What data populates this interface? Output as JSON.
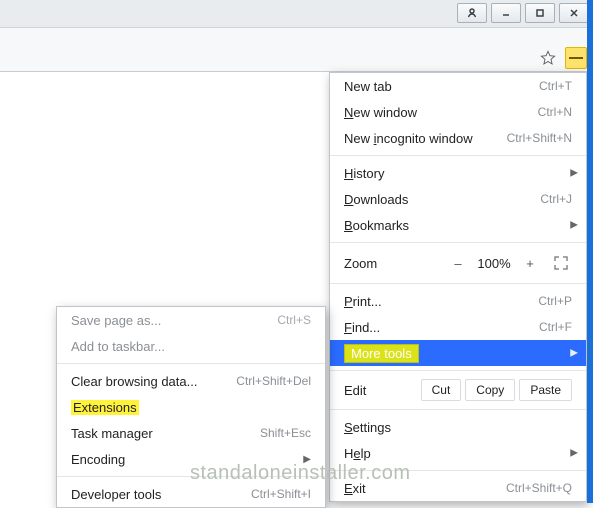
{
  "menu": {
    "new_tab": "New tab",
    "new_tab_sc": "Ctrl+T",
    "new_window": "New window",
    "new_window_sc": "Ctrl+N",
    "incognito": "New incognito window",
    "incognito_sc": "Ctrl+Shift+N",
    "history": "History",
    "downloads": "Downloads",
    "downloads_sc": "Ctrl+J",
    "bookmarks": "Bookmarks",
    "zoom_label": "Zoom",
    "zoom_minus": "–",
    "zoom_value": "100%",
    "zoom_plus": "+",
    "print": "Print...",
    "print_sc": "Ctrl+P",
    "find": "Find...",
    "find_sc": "Ctrl+F",
    "more_tools": "More tools",
    "edit": "Edit",
    "cut": "Cut",
    "copy": "Copy",
    "paste": "Paste",
    "settings": "Settings",
    "help": "Help",
    "exit": "Exit",
    "exit_sc": "Ctrl+Shift+Q"
  },
  "submenu": {
    "save_page": "Save page as...",
    "save_page_sc": "Ctrl+S",
    "add_taskbar": "Add to taskbar...",
    "clear_data": "Clear browsing data...",
    "clear_data_sc": "Ctrl+Shift+Del",
    "extensions": "Extensions",
    "task_manager": "Task manager",
    "task_manager_sc": "Shift+Esc",
    "encoding": "Encoding",
    "dev_tools": "Developer tools",
    "dev_tools_sc": "Ctrl+Shift+I"
  },
  "watermark": "standaloneinstaller.com"
}
